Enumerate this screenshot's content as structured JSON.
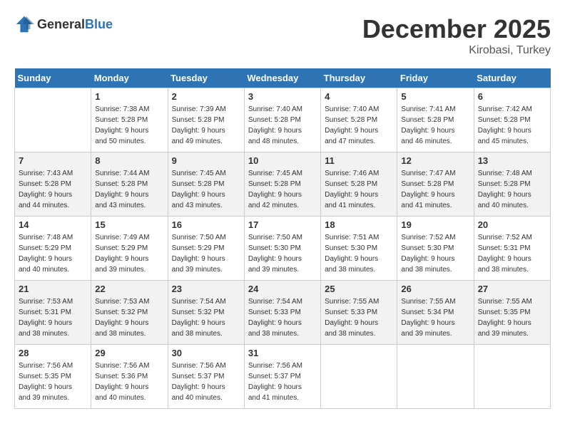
{
  "header": {
    "logo_general": "General",
    "logo_blue": "Blue",
    "month_title": "December 2025",
    "location": "Kirobasi, Turkey"
  },
  "weekdays": [
    "Sunday",
    "Monday",
    "Tuesday",
    "Wednesday",
    "Thursday",
    "Friday",
    "Saturday"
  ],
  "weeks": [
    [
      {
        "day": "",
        "info": ""
      },
      {
        "day": "1",
        "info": "Sunrise: 7:38 AM\nSunset: 5:28 PM\nDaylight: 9 hours\nand 50 minutes."
      },
      {
        "day": "2",
        "info": "Sunrise: 7:39 AM\nSunset: 5:28 PM\nDaylight: 9 hours\nand 49 minutes."
      },
      {
        "day": "3",
        "info": "Sunrise: 7:40 AM\nSunset: 5:28 PM\nDaylight: 9 hours\nand 48 minutes."
      },
      {
        "day": "4",
        "info": "Sunrise: 7:40 AM\nSunset: 5:28 PM\nDaylight: 9 hours\nand 47 minutes."
      },
      {
        "day": "5",
        "info": "Sunrise: 7:41 AM\nSunset: 5:28 PM\nDaylight: 9 hours\nand 46 minutes."
      },
      {
        "day": "6",
        "info": "Sunrise: 7:42 AM\nSunset: 5:28 PM\nDaylight: 9 hours\nand 45 minutes."
      }
    ],
    [
      {
        "day": "7",
        "info": "Sunrise: 7:43 AM\nSunset: 5:28 PM\nDaylight: 9 hours\nand 44 minutes."
      },
      {
        "day": "8",
        "info": "Sunrise: 7:44 AM\nSunset: 5:28 PM\nDaylight: 9 hours\nand 43 minutes."
      },
      {
        "day": "9",
        "info": "Sunrise: 7:45 AM\nSunset: 5:28 PM\nDaylight: 9 hours\nand 43 minutes."
      },
      {
        "day": "10",
        "info": "Sunrise: 7:45 AM\nSunset: 5:28 PM\nDaylight: 9 hours\nand 42 minutes."
      },
      {
        "day": "11",
        "info": "Sunrise: 7:46 AM\nSunset: 5:28 PM\nDaylight: 9 hours\nand 41 minutes."
      },
      {
        "day": "12",
        "info": "Sunrise: 7:47 AM\nSunset: 5:28 PM\nDaylight: 9 hours\nand 41 minutes."
      },
      {
        "day": "13",
        "info": "Sunrise: 7:48 AM\nSunset: 5:28 PM\nDaylight: 9 hours\nand 40 minutes."
      }
    ],
    [
      {
        "day": "14",
        "info": "Sunrise: 7:48 AM\nSunset: 5:29 PM\nDaylight: 9 hours\nand 40 minutes."
      },
      {
        "day": "15",
        "info": "Sunrise: 7:49 AM\nSunset: 5:29 PM\nDaylight: 9 hours\nand 39 minutes."
      },
      {
        "day": "16",
        "info": "Sunrise: 7:50 AM\nSunset: 5:29 PM\nDaylight: 9 hours\nand 39 minutes."
      },
      {
        "day": "17",
        "info": "Sunrise: 7:50 AM\nSunset: 5:30 PM\nDaylight: 9 hours\nand 39 minutes."
      },
      {
        "day": "18",
        "info": "Sunrise: 7:51 AM\nSunset: 5:30 PM\nDaylight: 9 hours\nand 38 minutes."
      },
      {
        "day": "19",
        "info": "Sunrise: 7:52 AM\nSunset: 5:30 PM\nDaylight: 9 hours\nand 38 minutes."
      },
      {
        "day": "20",
        "info": "Sunrise: 7:52 AM\nSunset: 5:31 PM\nDaylight: 9 hours\nand 38 minutes."
      }
    ],
    [
      {
        "day": "21",
        "info": "Sunrise: 7:53 AM\nSunset: 5:31 PM\nDaylight: 9 hours\nand 38 minutes."
      },
      {
        "day": "22",
        "info": "Sunrise: 7:53 AM\nSunset: 5:32 PM\nDaylight: 9 hours\nand 38 minutes."
      },
      {
        "day": "23",
        "info": "Sunrise: 7:54 AM\nSunset: 5:32 PM\nDaylight: 9 hours\nand 38 minutes."
      },
      {
        "day": "24",
        "info": "Sunrise: 7:54 AM\nSunset: 5:33 PM\nDaylight: 9 hours\nand 38 minutes."
      },
      {
        "day": "25",
        "info": "Sunrise: 7:55 AM\nSunset: 5:33 PM\nDaylight: 9 hours\nand 38 minutes."
      },
      {
        "day": "26",
        "info": "Sunrise: 7:55 AM\nSunset: 5:34 PM\nDaylight: 9 hours\nand 39 minutes."
      },
      {
        "day": "27",
        "info": "Sunrise: 7:55 AM\nSunset: 5:35 PM\nDaylight: 9 hours\nand 39 minutes."
      }
    ],
    [
      {
        "day": "28",
        "info": "Sunrise: 7:56 AM\nSunset: 5:35 PM\nDaylight: 9 hours\nand 39 minutes."
      },
      {
        "day": "29",
        "info": "Sunrise: 7:56 AM\nSunset: 5:36 PM\nDaylight: 9 hours\nand 40 minutes."
      },
      {
        "day": "30",
        "info": "Sunrise: 7:56 AM\nSunset: 5:37 PM\nDaylight: 9 hours\nand 40 minutes."
      },
      {
        "day": "31",
        "info": "Sunrise: 7:56 AM\nSunset: 5:37 PM\nDaylight: 9 hours\nand 41 minutes."
      },
      {
        "day": "",
        "info": ""
      },
      {
        "day": "",
        "info": ""
      },
      {
        "day": "",
        "info": ""
      }
    ]
  ]
}
